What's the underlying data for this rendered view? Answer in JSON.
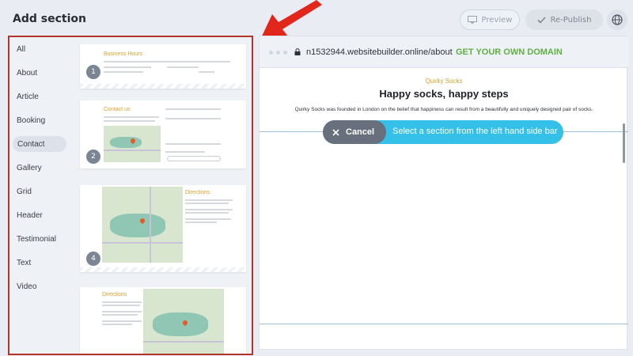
{
  "header": {
    "title": "Add section",
    "preview_label": "Preview",
    "republish_label": "Re-Publish"
  },
  "sidebar": {
    "categories": [
      "All",
      "About",
      "Article",
      "Booking",
      "Contact",
      "Gallery",
      "Grid",
      "Header",
      "Testimonial",
      "Text",
      "Video"
    ],
    "active": "Contact"
  },
  "thumbnails": [
    {
      "badge": "1",
      "heading": "Business Hours"
    },
    {
      "badge": "2",
      "heading": "Contact us"
    },
    {
      "badge": "4",
      "heading": "Directions"
    },
    {
      "badge": "",
      "heading": "Directions"
    }
  ],
  "browser": {
    "url": "n1532944.websitebuilder.online/about",
    "domain_cta": "GET YOUR OWN DOMAIN"
  },
  "site": {
    "eyebrow": "Quirky Socks",
    "title": "Happy socks, happy steps",
    "body": "Quirky Socks was founded in London on the belief that happiness can result from a beautifully and uniquely designed pair of socks."
  },
  "overlay": {
    "cancel_label": "Cancel",
    "hint": "Select a section from the left hand side bar"
  },
  "colors": {
    "accent_blue": "#34c0e8",
    "domain_green": "#5fb043",
    "highlight_red": "#b0362b",
    "heading_gold": "#d9a12e"
  }
}
